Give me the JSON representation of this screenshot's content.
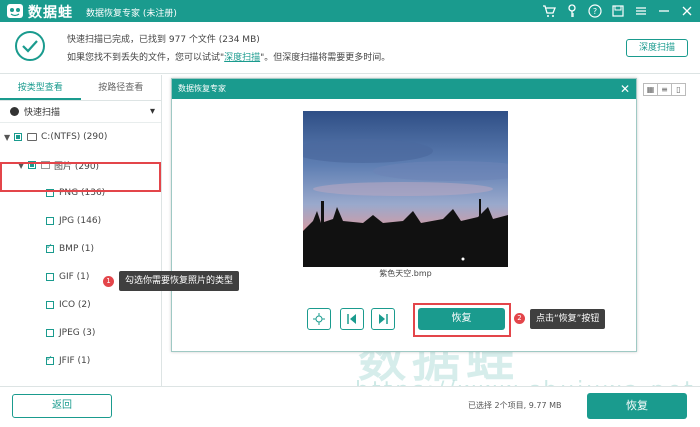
{
  "titlebar": {
    "app_name": "数据蛙",
    "subtitle": "数据恢复专家 (未注册)",
    "icons": [
      "cart-icon",
      "key-icon",
      "help-icon",
      "save-icon",
      "menu-icon",
      "minimize-icon",
      "close-icon"
    ]
  },
  "status": {
    "line1": "快速扫描已完成，已找到 977 个文件 (234 MB)",
    "line2_pre": "如果您找不到丢失的文件，您可以试试\"",
    "line2_link": "深度扫描",
    "line2_post": "\"。但深度扫描将需要更多时间。",
    "deep_scan_button": "深度扫描"
  },
  "sidebar": {
    "tabs": [
      "按类型查看",
      "按路径查看"
    ],
    "quickscan_label": "快速扫描",
    "tree": [
      {
        "label": "C:(NTFS) (290)"
      },
      {
        "label": "图片 (290)"
      },
      {
        "label": "PNG (136)"
      },
      {
        "label": "JPG (146)"
      },
      {
        "label": "BMP (1)"
      },
      {
        "label": "GIF (1)"
      },
      {
        "label": "ICO (2)"
      },
      {
        "label": "JPEG (3)"
      },
      {
        "label": "JFIF (1)"
      }
    ]
  },
  "dialog": {
    "title": "数据恢复专家",
    "caption": "紫色天空.bmp",
    "restore_button": "恢复"
  },
  "callouts": {
    "one_num": "1",
    "one_text": "勾选你需要恢复照片的类型",
    "two_num": "2",
    "two_text": "点击“恢复”按钮"
  },
  "watermark": {
    "line1": "数据蛙",
    "line2": "https://www.shujuwa.net"
  },
  "bottom": {
    "back_button": "返回",
    "selected_info": "已选择 2个项目, 9.77 MB",
    "restore_button": "恢复"
  },
  "colors": {
    "accent": "#1a9b8e",
    "highlight_red": "#e3454a"
  }
}
